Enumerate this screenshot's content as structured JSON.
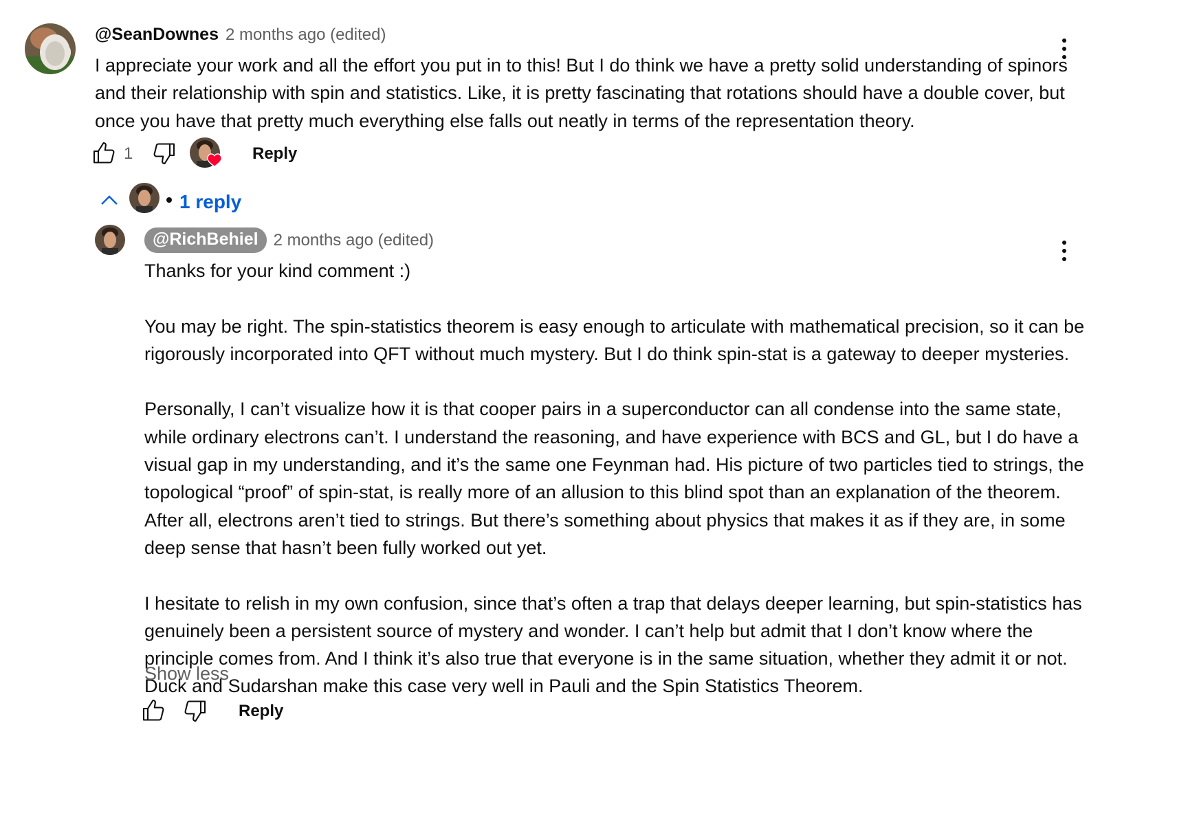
{
  "comment": {
    "author": "@SeanDownes",
    "time": "2 months ago (edited)",
    "text_lines": [
      "I appreciate your work and all the effort you put in to this! But I do think we have a pretty solid understanding of spinors",
      "and their relationship with spin and statistics. Like, it is pretty fascinating that rotations should have a double cover, but",
      "once you have that pretty much everything else falls out neatly in terms of the representation theory."
    ],
    "like_count": "1",
    "reply_label": "Reply",
    "replies_toggle": "1 reply",
    "icons": {
      "like": "thumbs-up-icon",
      "dislike": "thumbs-down-icon",
      "creator_heart": "heart-icon",
      "menu": "more-vert-icon",
      "collapse": "chevron-up-icon"
    },
    "colors": {
      "heart": "#ff0033",
      "link": "#065fd4",
      "pill": "#8e8e8e"
    }
  },
  "reply": {
    "author": "@RichBehiel",
    "time": "2 months ago (edited)",
    "paragraphs": [
      [
        "Thanks for your kind comment :)"
      ],
      [
        "You may be right. The spin-statistics theorem is easy enough to articulate with mathematical precision, so it can be",
        "rigorously incorporated into QFT without much mystery. But I do think spin-stat is a gateway to deeper mysteries."
      ],
      [
        "Personally, I can’t visualize how it is that cooper pairs in a superconductor can all condense into the same state,",
        "while ordinary electrons can’t. I understand the reasoning, and have experience with BCS and GL, but I do have a",
        "visual gap in my understanding, and it’s the same one Feynman had. His picture of two particles tied to strings, the",
        "topological “proof” of spin-stat, is really more of an allusion to this blind spot than an explanation of the theorem.",
        "After all, electrons aren’t tied to strings. But there’s something about physics that makes it as if they are, in some",
        "deep sense that hasn’t been fully worked out yet."
      ],
      [
        "I hesitate to relish in my own confusion, since that’s often a trap that delays deeper learning, but spin-statistics has",
        "genuinely been a persistent source of mystery and wonder. I can’t help but admit that I don’t know where the",
        "principle comes from. And I think it’s also true that everyone is in the same situation, whether they admit it or not.",
        "Duck and Sudarshan make this case very well in Pauli and the Spin Statistics Theorem."
      ]
    ],
    "show_less": "Show less",
    "reply_label": "Reply"
  }
}
